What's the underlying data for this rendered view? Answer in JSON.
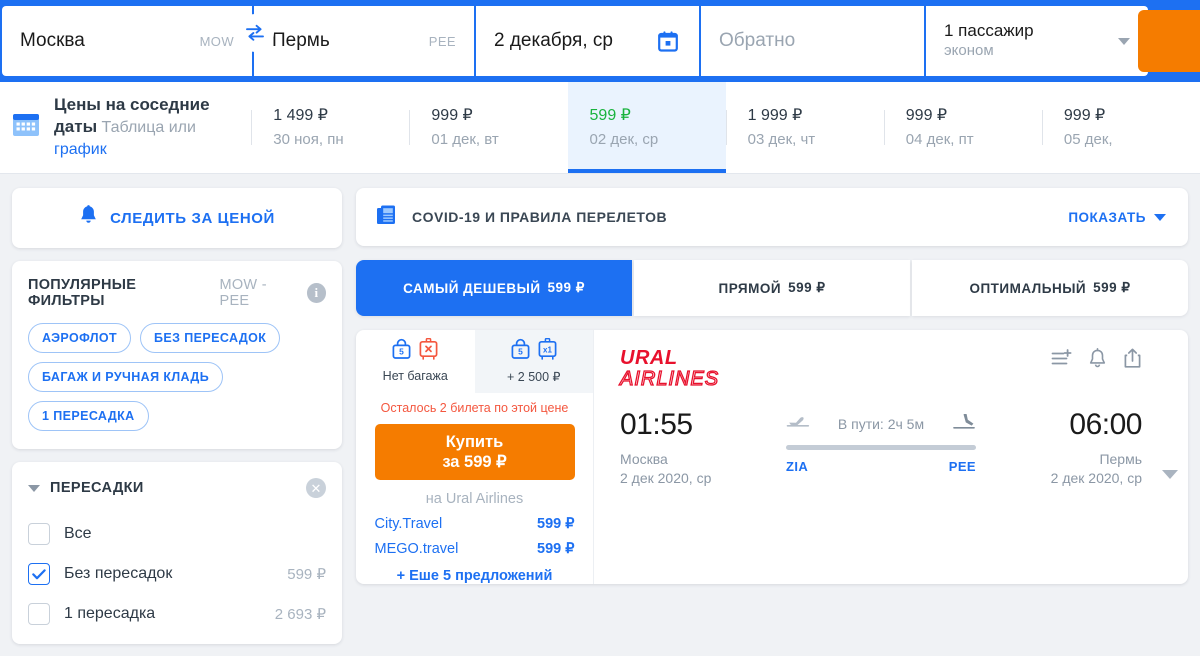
{
  "search": {
    "origin": {
      "city": "Москва",
      "code": "MOW"
    },
    "destination": {
      "city": "Пермь",
      "code": "PEE"
    },
    "date_out": "2 декабря, ср",
    "date_back_placeholder": "Обратно",
    "passengers": "1 пассажир",
    "cabin_class": "эконом",
    "swap_icon": "swap-horizontal-icon",
    "calendar_icon": "calendar-icon",
    "submit_icon": "search-icon"
  },
  "price_calendar": {
    "title": "Цены на соседние даты",
    "subtitle_table": "Таблица",
    "subtitle_or": " или ",
    "subtitle_chart": "график",
    "icon": "calendar-grid-icon",
    "days": [
      {
        "price": "1 499 ₽",
        "date": "30 ноя, пн",
        "active": false
      },
      {
        "price": "999 ₽",
        "date": "01 дек, вт",
        "active": false
      },
      {
        "price": "599 ₽",
        "date": "02 дек, ср",
        "active": true
      },
      {
        "price": "1 999 ₽",
        "date": "03 дек, чт",
        "active": false
      },
      {
        "price": "999 ₽",
        "date": "04 дек, пт",
        "active": false
      },
      {
        "price": "999 ₽",
        "date": "05 дек,",
        "active": false
      }
    ]
  },
  "sidebar": {
    "watch_price": {
      "label": "СЛЕДИТЬ ЗА ЦЕНОЙ",
      "icon": "bell-icon"
    },
    "popular_filters": {
      "title": "ПОПУЛЯРНЫЕ ФИЛЬТРЫ",
      "route": "MOW - PEE",
      "info_icon": "info-icon",
      "info_glyph": "i",
      "chips": [
        "АЭРОФЛОТ",
        "БЕЗ ПЕРЕСАДОК",
        "БАГАЖ И РУЧНАЯ КЛАДЬ",
        "1 ПЕРЕСАДКА"
      ]
    },
    "stops": {
      "title": "ПЕРЕСАДКИ",
      "collapse_icon": "chevron-down-icon",
      "clear_icon": "close-icon",
      "clear_glyph": "✕",
      "options": [
        {
          "label": "Все",
          "price": "",
          "checked": false
        },
        {
          "label": "Без пересадок",
          "price": "599 ₽",
          "checked": true
        },
        {
          "label": "1 пересадка",
          "price": "2 693 ₽",
          "checked": false
        }
      ]
    }
  },
  "covid_banner": {
    "icon": "document-icon",
    "label": "COVID-19 И ПРАВИЛА ПЕРЕЛЕТОВ",
    "action": "ПОКАЗАТЬ"
  },
  "tabs": [
    {
      "label": "САМЫЙ ДЕШЕВЫЙ",
      "price": "599 ₽",
      "active": true
    },
    {
      "label": "ПРЯМОЙ",
      "price": "599 ₽",
      "active": false
    },
    {
      "label": "ОПТИМАЛЬНЫЙ",
      "price": "599 ₽",
      "active": false
    }
  ],
  "flight": {
    "baggage_options": [
      {
        "caption": "Нет багажа",
        "handbag_kg": "5",
        "suitcase_mark": "✕",
        "selected": false
      },
      {
        "caption": "+ 2 500 ₽",
        "handbag_kg": "5",
        "suitcase_mark": "x1",
        "selected": true
      }
    ],
    "seats_left": "Осталось 2 билета по этой цене",
    "buy_line1": "Купить",
    "buy_line2": "за 599 ₽",
    "on_airline": "на Ural Airlines",
    "agents": [
      {
        "name": "City.Travel",
        "price": "599 ₽"
      },
      {
        "name": "MEGO.travel",
        "price": "599 ₽"
      }
    ],
    "more_offers": "+ Еше 5 предложений",
    "airline_logo": {
      "line1": "URAL",
      "line2": "AIRLINES",
      "icon": "ural-airlines-logo"
    },
    "actions": [
      {
        "icon": "add-to-compare-icon"
      },
      {
        "icon": "bell-icon"
      },
      {
        "icon": "share-icon"
      }
    ],
    "depart": {
      "time": "01:55",
      "city": "Москва",
      "date": "2 дек 2020, ср",
      "airport_code": "ZIA"
    },
    "arrive": {
      "time": "06:00",
      "city": "Пермь",
      "date": "2 дек 2020, ср",
      "airport_code": "PEE"
    },
    "duration": "В пути: 2ч 5м",
    "takeoff_icon": "plane-takeoff-icon",
    "landing_icon": "plane-landing-icon",
    "expand_icon": "chevron-down-icon"
  },
  "colors": {
    "brand_blue": "#1d70f2",
    "orange": "#f57c00",
    "green": "#19b33d",
    "red": "#f4573f",
    "airline_red": "#e8112d"
  }
}
